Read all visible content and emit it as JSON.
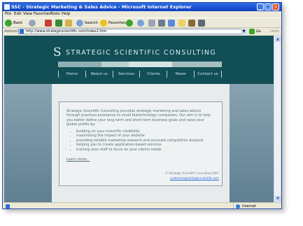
{
  "window": {
    "title": "SSC - Strategic Marketing & Sales Advice - Microsoft Internet Explorer"
  },
  "menubar": {
    "items": [
      "File",
      "Edit",
      "View",
      "Favorites",
      "Tools",
      "Help"
    ]
  },
  "toolbar": {
    "back_label": "Back",
    "search_label": "Search",
    "favorites_label": "Favorites"
  },
  "addressbar": {
    "label": "Address",
    "url": "http://www.strategicscientific.com/index2.htm",
    "go_label": "Go",
    "links_label": "Links"
  },
  "site": {
    "logo_glyph": "S",
    "name": "STRATEGIC SCIENTIFIC CONSULTING",
    "nav": [
      "Home",
      "About us",
      "Services",
      "Clients",
      "News",
      "Contact us"
    ],
    "intro": "Strategic Scientific Consulting provides strategic marketing and sales advice through practical assistance to small biotechnology companies. Our aim is to help you better define your long term and short term business goals and raise your global profile by:",
    "bullets": [
      "building on your scientific credibility",
      "maximising the impact of your website",
      "providing reliable marketing research and accurate competition analysis",
      "helping you to create application-based services",
      "training your staff to focus on your clients needs"
    ],
    "learn_more": "Learn more...",
    "copyright": "© Strategic Scientific Consulting 2007",
    "email": "customers@strategicscientific.com"
  },
  "statusbar": {
    "zone": "Internet"
  },
  "colors": {
    "header_bg": "#114e56",
    "page_bg": "#6f8da0",
    "content_bg": "#e7ebeb",
    "text": "#556f74",
    "titlebar": "#0f3fc0"
  }
}
